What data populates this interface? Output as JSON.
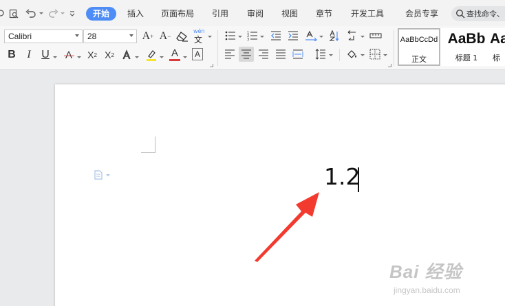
{
  "tabs": {
    "active": "开始",
    "items": [
      "插入",
      "页面布局",
      "引用",
      "审阅",
      "视图",
      "章节",
      "开发工具",
      "会员专享"
    ]
  },
  "search": {
    "placeholder": "查找命令、"
  },
  "font": {
    "name": "Calibri",
    "size": "28"
  },
  "phonetic_label": "wén",
  "styles": {
    "normal_preview": "AaBbCcDd",
    "normal_name": "正文",
    "h1_preview": "AaBb",
    "h1_name": "标题 1",
    "h2_preview": "AaB",
    "h2_name": "标"
  },
  "document": {
    "text": "1.2"
  },
  "watermark": {
    "main": "Bai 经验",
    "sub": "jingyan.baidu.com"
  },
  "colors": {
    "accent": "#4e8df5",
    "font_color_bar": "#d83b3b",
    "highlight_bar": "#f5e42a",
    "arrow": "#f23a2f"
  }
}
